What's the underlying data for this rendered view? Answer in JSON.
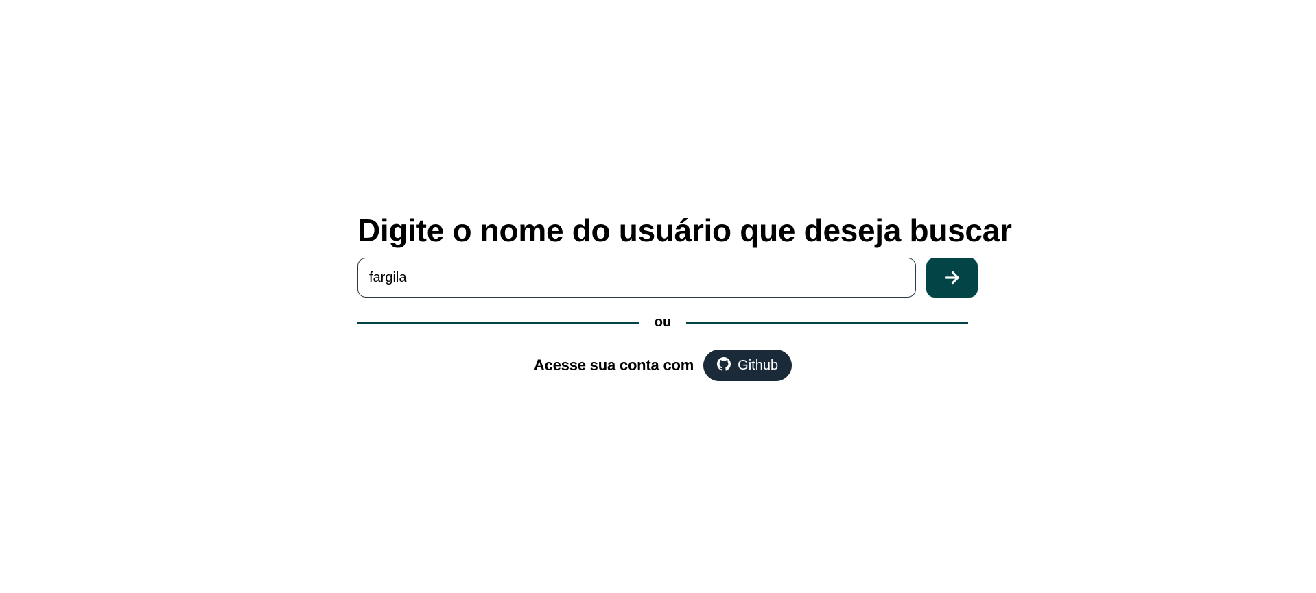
{
  "heading": "Digite o nome do usuário que deseja buscar",
  "search": {
    "value": "fargila",
    "submit_icon": "arrow-right-icon"
  },
  "divider": {
    "label": "ou"
  },
  "login": {
    "label": "Acesse sua conta com",
    "button_label": "Github",
    "button_icon": "github-icon"
  },
  "colors": {
    "accent": "#034447",
    "github_button": "#1b2a39",
    "input_border": "#2b3a46"
  }
}
